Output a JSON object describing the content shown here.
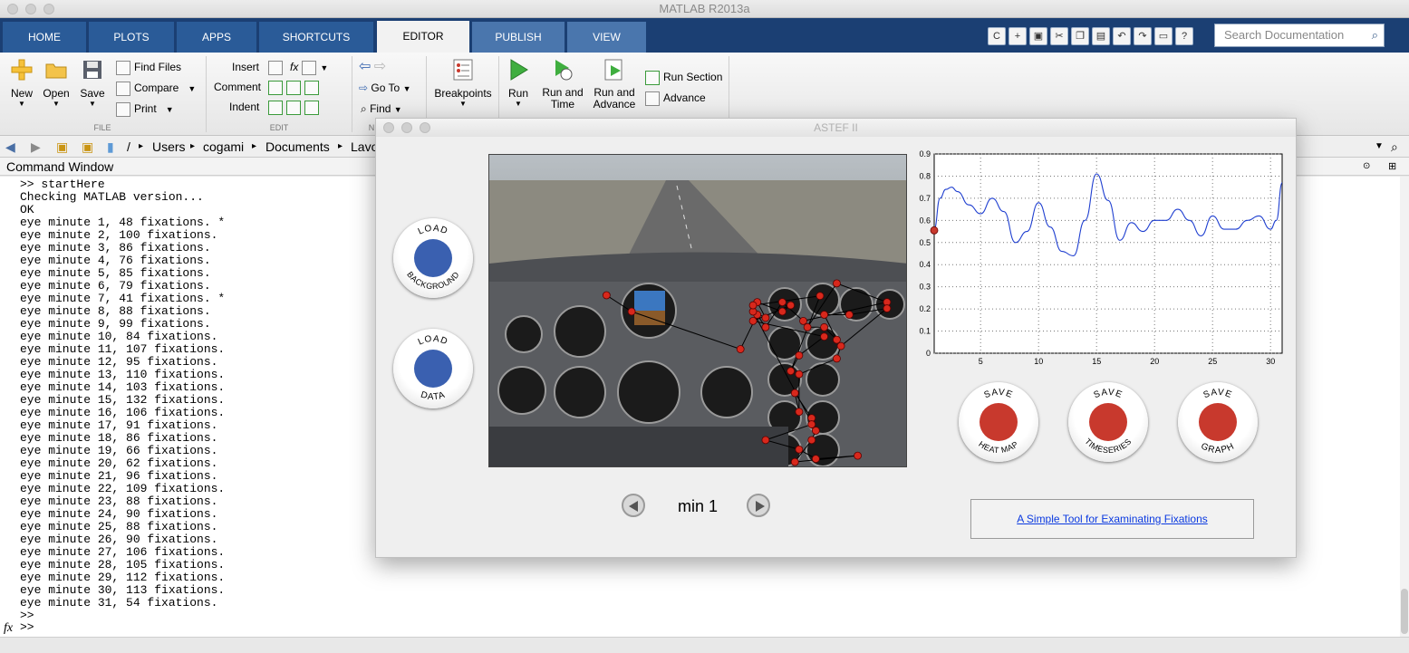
{
  "app": {
    "title": "MATLAB R2013a"
  },
  "tabs": [
    {
      "label": "HOME",
      "state": "normal"
    },
    {
      "label": "PLOTS",
      "state": "normal"
    },
    {
      "label": "APPS",
      "state": "normal"
    },
    {
      "label": "SHORTCUTS",
      "state": "normal"
    },
    {
      "label": "EDITOR",
      "state": "active"
    },
    {
      "label": "PUBLISH",
      "state": "dim"
    },
    {
      "label": "VIEW",
      "state": "dim"
    }
  ],
  "search": {
    "placeholder": "Search Documentation"
  },
  "ribbon": {
    "file": {
      "new": "New",
      "open": "Open",
      "save": "Save",
      "find_files": "Find Files",
      "compare": "Compare",
      "print": "Print",
      "group": "FILE"
    },
    "edit": {
      "insert": "Insert",
      "comment": "Comment",
      "indent": "Indent",
      "group": "EDIT",
      "fx": "fx"
    },
    "navigate": {
      "go_to": "Go To",
      "find": "Find",
      "group": "N"
    },
    "breakpoints": {
      "label": "Breakpoints"
    },
    "run": {
      "run": "Run",
      "run_time": "Run and\nTime",
      "run_advance": "Run and\nAdvance",
      "run_section": "Run Section",
      "advance": "Advance"
    }
  },
  "address": {
    "root": "/",
    "parts": [
      "Users",
      "cogami",
      "Documents",
      "Lavo"
    ]
  },
  "command_window": {
    "title": "Command Window",
    "lines": [
      ">> startHere",
      "Checking MATLAB version...",
      "OK",
      "eye minute 1, 48 fixations. *",
      "eye minute 2, 100 fixations.",
      "eye minute 3, 86 fixations.",
      "eye minute 4, 76 fixations.",
      "eye minute 5, 85 fixations.",
      "eye minute 6, 79 fixations.",
      "eye minute 7, 41 fixations. *",
      "eye minute 8, 88 fixations.",
      "eye minute 9, 99 fixations.",
      "eye minute 10, 84 fixations.",
      "eye minute 11, 107 fixations.",
      "eye minute 12, 95 fixations.",
      "eye minute 13, 110 fixations.",
      "eye minute 14, 103 fixations.",
      "eye minute 15, 132 fixations.",
      "eye minute 16, 106 fixations.",
      "eye minute 17, 91 fixations.",
      "eye minute 18, 86 fixations.",
      "eye minute 19, 66 fixations.",
      "eye minute 20, 62 fixations.",
      "eye minute 21, 96 fixations.",
      "eye minute 22, 109 fixations.",
      "eye minute 23, 88 fixations.",
      "eye minute 24, 90 fixations.",
      "eye minute 25, 88 fixations.",
      "eye minute 26, 90 fixations.",
      "eye minute 27, 106 fixations.",
      "eye minute 28, 105 fixations.",
      "eye minute 29, 112 fixations.",
      "eye minute 30, 113 fixations.",
      "eye minute 31, 54 fixations.",
      ">>"
    ],
    "prompt": ">>",
    "fx": "fx"
  },
  "astef": {
    "title": "ASTEF II",
    "buttons": {
      "load_background": {
        "line1": "LOAD",
        "line2": "BACKGROUND",
        "color": "#3a60b0"
      },
      "load_data": {
        "line1": "LOAD",
        "line2": "DATA",
        "color": "#3a60b0"
      },
      "save_heatmap": {
        "line1": "SAVE",
        "line2": "HEAT MAP",
        "color": "#c8392d"
      },
      "save_timeseries": {
        "line1": "SAVE",
        "line2": "TIMESERIES",
        "color": "#c8392d"
      },
      "save_graph": {
        "line1": "SAVE",
        "line2": "GRAPH",
        "color": "#c8392d"
      }
    },
    "minute_label": "min 1",
    "link_text": "A Simple Tool for Examinating Fixations"
  },
  "chart_data": {
    "type": "line",
    "title": "",
    "xlabel": "",
    "ylabel": "",
    "xlim": [
      1,
      31
    ],
    "ylim": [
      0,
      0.9
    ],
    "xticks": [
      5,
      10,
      15,
      20,
      25,
      30
    ],
    "yticks": [
      0,
      0.1,
      0.2,
      0.3,
      0.4,
      0.5,
      0.6,
      0.7,
      0.8,
      0.9
    ],
    "grid": true,
    "series": [
      {
        "color": "#1f3fd0",
        "x": [
          1,
          1.5,
          2,
          2.5,
          3,
          4,
          5,
          6,
          7,
          8,
          9,
          10,
          11,
          12,
          13,
          14,
          15,
          16,
          17,
          18,
          19,
          20,
          21,
          22,
          23,
          24,
          25,
          26,
          27,
          28,
          29,
          30,
          30.5,
          31
        ],
        "y": [
          0.56,
          0.7,
          0.74,
          0.75,
          0.73,
          0.67,
          0.63,
          0.7,
          0.64,
          0.5,
          0.55,
          0.68,
          0.57,
          0.46,
          0.44,
          0.6,
          0.81,
          0.69,
          0.51,
          0.59,
          0.55,
          0.6,
          0.6,
          0.65,
          0.6,
          0.53,
          0.62,
          0.56,
          0.56,
          0.6,
          0.62,
          0.56,
          0.6,
          0.77
        ]
      }
    ],
    "marker": {
      "x": 1,
      "y": 0.555,
      "color": "#c8392d"
    }
  },
  "fixations": {
    "points": [
      [
        0.28,
        0.448
      ],
      [
        0.34,
        0.5
      ],
      [
        0.6,
        0.62
      ],
      [
        0.64,
        0.51
      ],
      [
        0.66,
        0.55
      ],
      [
        0.7,
        0.47
      ],
      [
        0.75,
        0.53
      ],
      [
        0.95,
        0.47
      ],
      [
        0.83,
        0.41
      ],
      [
        0.76,
        0.55
      ],
      [
        0.8,
        0.55
      ],
      [
        0.83,
        0.59
      ],
      [
        0.8,
        0.51
      ],
      [
        0.86,
        0.51
      ],
      [
        0.95,
        0.49
      ],
      [
        0.84,
        0.61
      ],
      [
        0.83,
        0.65
      ],
      [
        0.74,
        0.7
      ],
      [
        0.74,
        0.82
      ],
      [
        0.73,
        0.76
      ],
      [
        0.77,
        0.84
      ],
      [
        0.77,
        0.86
      ],
      [
        0.66,
        0.91
      ],
      [
        0.74,
        0.94
      ],
      [
        0.78,
        0.97
      ],
      [
        0.88,
        0.96
      ],
      [
        0.73,
        0.98
      ],
      [
        0.77,
        0.91
      ],
      [
        0.78,
        0.88
      ],
      [
        0.63,
        0.5
      ],
      [
        0.66,
        0.52
      ],
      [
        0.64,
        0.47
      ],
      [
        0.7,
        0.5
      ],
      [
        0.72,
        0.48
      ],
      [
        0.63,
        0.53
      ],
      [
        0.8,
        0.58
      ],
      [
        0.74,
        0.64
      ],
      [
        0.72,
        0.69
      ],
      [
        0.79,
        0.45
      ],
      [
        0.63,
        0.48
      ]
    ]
  }
}
